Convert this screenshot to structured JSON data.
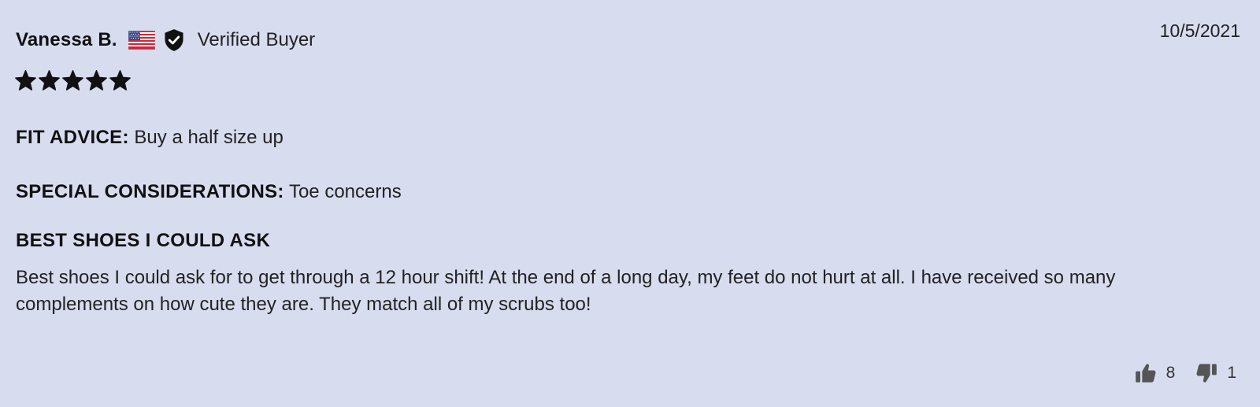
{
  "reviewer": {
    "name": "Vanessa B.",
    "flag_icon": "us-flag-icon",
    "verified_icon": "shield-check-icon",
    "verified_label": "Verified Buyer"
  },
  "date": "10/5/2021",
  "rating": {
    "stars": 5,
    "max": 5
  },
  "fit_advice": {
    "label": "FIT ADVICE:",
    "value": "Buy a half size up"
  },
  "special_considerations": {
    "label": "SPECIAL CONSIDERATIONS:",
    "value": "Toe concerns"
  },
  "review": {
    "title": "BEST SHOES I COULD ASK",
    "body": "Best shoes I could ask for to get through a 12 hour shift! At the end of a long day, my feet do not hurt at all. I have received so many complements on how cute they are. They match all of my scrubs too!"
  },
  "votes": {
    "up_icon": "thumbs-up-icon",
    "up_count": "8",
    "down_icon": "thumbs-down-icon",
    "down_count": "1"
  },
  "colors": {
    "background": "#d7dcef",
    "text": "#111111",
    "icon": "#555555"
  }
}
